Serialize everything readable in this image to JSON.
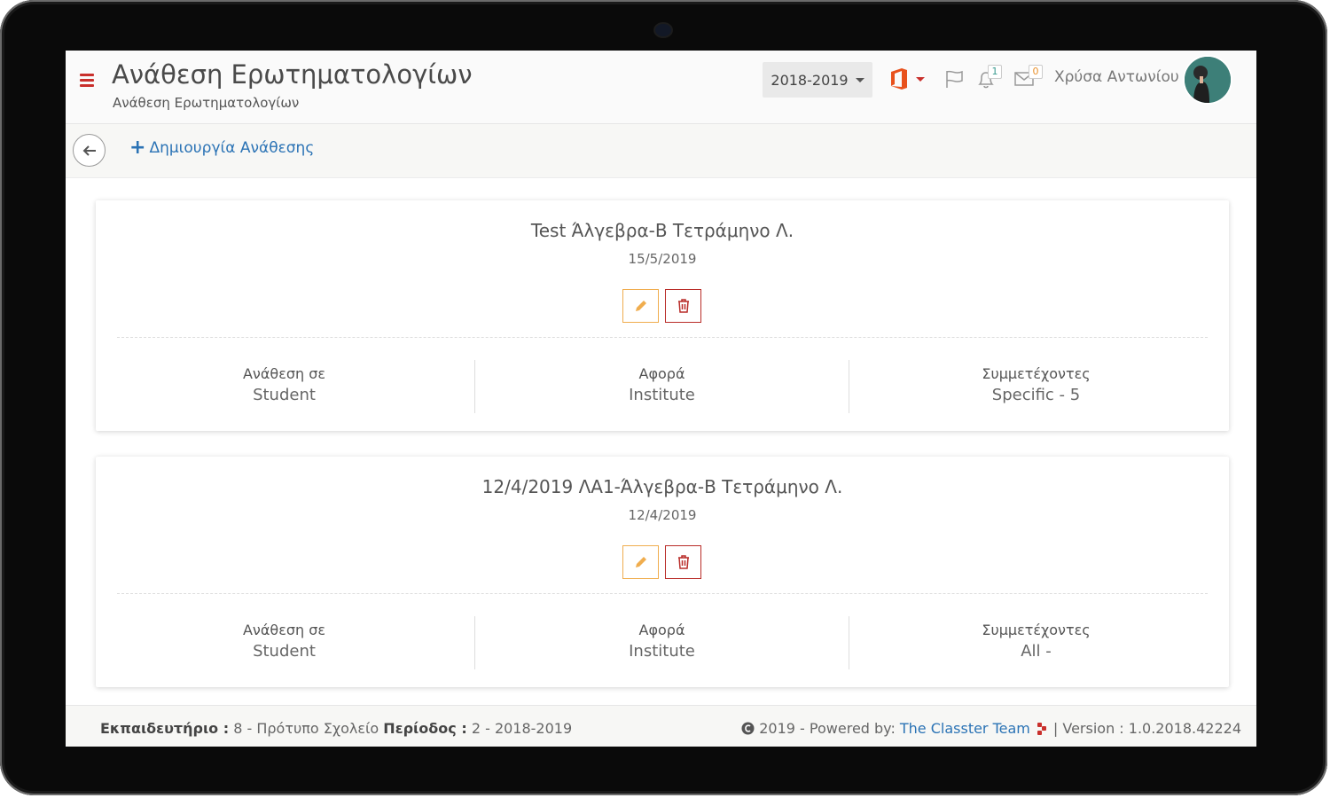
{
  "header": {
    "title": "Ανάθεση Ερωτηματολογίων",
    "subtitle": "Ανάθεση Ερωτηματολογίων",
    "year_select": "2018-2019",
    "notifications_count": "1",
    "messages_count": "0",
    "user_name": "Χρύσα Αντωνίου"
  },
  "toolbar": {
    "create_label": "Δημιουργία Ανάθεσης"
  },
  "cards": [
    {
      "title": "Test Άλγεβρα-Β Τετράμηνο Λ.",
      "date": "15/5/2019",
      "columns": [
        {
          "label": "Ανάθεση σε",
          "value": "Student"
        },
        {
          "label": "Αφορά",
          "value": "Institute"
        },
        {
          "label": "Συμμετέχοντες",
          "value": "Specific - 5"
        }
      ]
    },
    {
      "title": "12/4/2019 ΛΑ1-Άλγεβρα-Β Τετράμηνο Λ.",
      "date": "12/4/2019",
      "columns": [
        {
          "label": "Ανάθεση σε",
          "value": "Student"
        },
        {
          "label": "Αφορά",
          "value": "Institute"
        },
        {
          "label": "Συμμετέχοντες",
          "value": "All -"
        }
      ]
    }
  ],
  "footer": {
    "school_label": "Εκπαιδευτήριο :",
    "school_value": "8 - Πρότυπο Σχολείο",
    "period_label": "Περίοδος :",
    "period_value": "2 - 2018-2019",
    "copyright": "2019 - Powered by:",
    "team_link": "The Classter Team",
    "version": "| Version : 1.0.2018.42224"
  },
  "colors": {
    "accent_red": "#c9302c",
    "edit_orange": "#f0ad4e",
    "link_blue": "#2b73b5"
  }
}
